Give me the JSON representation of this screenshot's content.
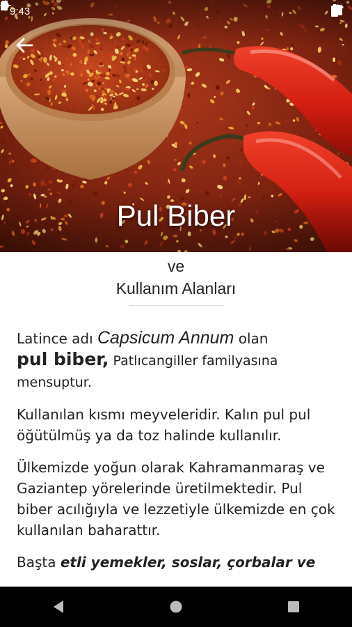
{
  "status_bar": {
    "time": "9:43"
  },
  "hero": {
    "title": "Pul Biber"
  },
  "subtitle": {
    "line1": "ve",
    "line2": "Kullanım Alanları"
  },
  "paragraphs": {
    "p1": {
      "part1": "Latince adı ",
      "latin": "Capsicum Annum",
      "part2": " olan",
      "bold": "pul biber,",
      "rest": " Patlıcangiller familyasına mensuptur."
    },
    "p2": "Kullanılan kısmı meyveleridir. Kalın pul pul öğütülmüş ya da toz halinde kullanılır.",
    "p3": "Ülkemizde yoğun olarak  Kahramanmaraş ve Gaziantep yörelerinde üretilmektedir. Pul biber acılığıyla ve lezzetiyle ülkemizde en çok kullanılan baharattır.",
    "p4": {
      "lead": "Başta ",
      "emph": "etli yemekler, soslar, çorbalar ve"
    }
  }
}
